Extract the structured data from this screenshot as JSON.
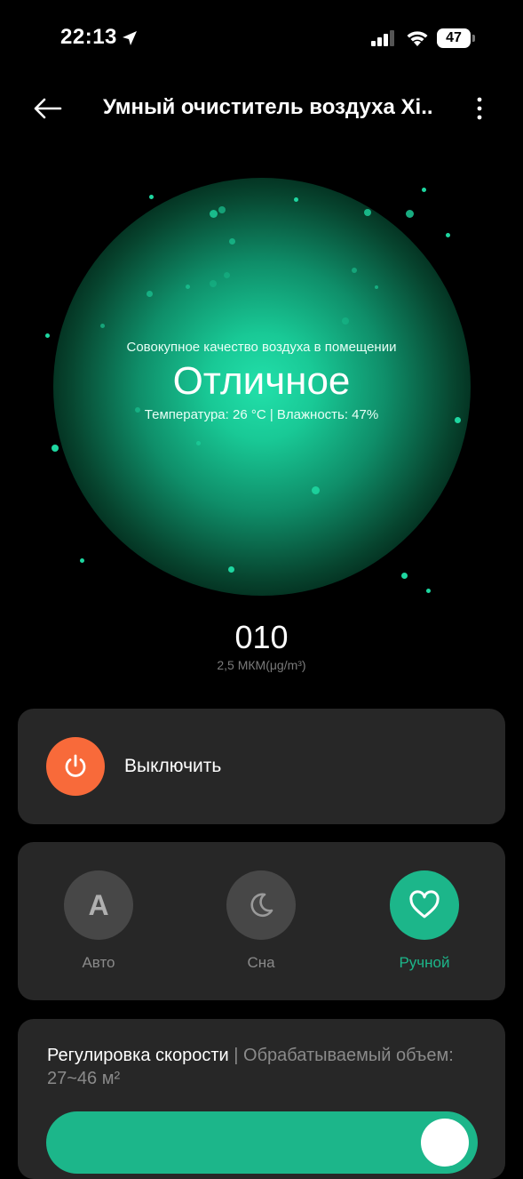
{
  "status_bar": {
    "time": "22:13",
    "battery": "47",
    "icons": [
      "location-arrow-icon",
      "signal-icon",
      "wifi-icon",
      "battery-icon"
    ]
  },
  "header": {
    "title": "Умный очиститель воздуха Xi...",
    "back_icon": "arrow-left-icon",
    "more_icon": "more-vertical-icon"
  },
  "air_quality": {
    "label": "Совокупное качество воздуха в помещении",
    "value": "Отличное",
    "details": "Температура: 26 °C | Влажность: 47%"
  },
  "pm": {
    "value": "010",
    "unit": "2,5 МКМ(μg/m³)"
  },
  "power": {
    "label": "Выключить",
    "icon": "power-icon",
    "color": "#f86a3a"
  },
  "modes": [
    {
      "label": "Авто",
      "icon": "letter-a-icon",
      "active": false
    },
    {
      "label": "Сна",
      "icon": "moon-icon",
      "active": false
    },
    {
      "label": "Ручной",
      "icon": "heart-icon",
      "active": true
    }
  ],
  "speed": {
    "title": "Регулировка скорости",
    "separator": " | ",
    "description": "Обрабатываемый объем: 27~46 м²"
  },
  "colors": {
    "accent": "#1cb68a",
    "card": "#272727",
    "background": "#000000"
  }
}
